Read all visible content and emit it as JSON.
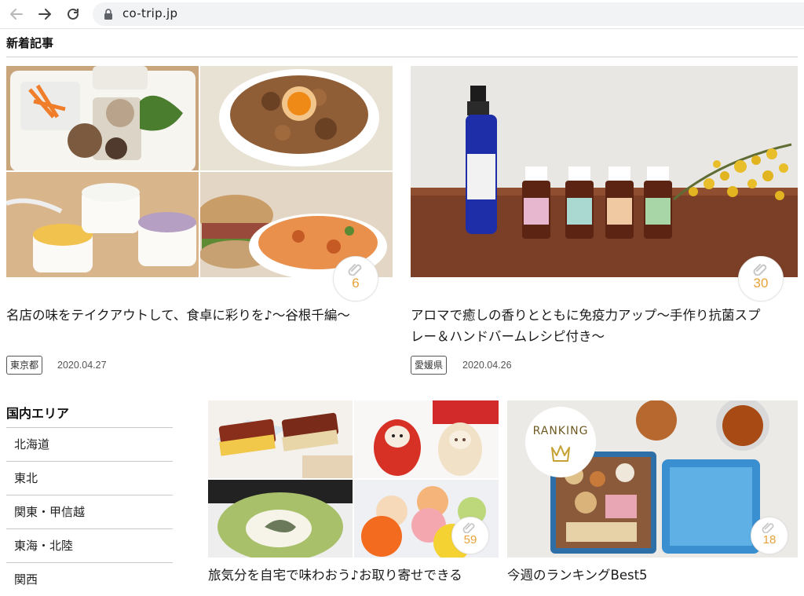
{
  "browser": {
    "url": "co-trip.jp",
    "icons": [
      "back-arrow-icon",
      "forward-arrow-icon",
      "reload-icon",
      "lock-icon"
    ]
  },
  "section": {
    "title": "新着記事"
  },
  "featured": [
    {
      "title": "名店の味をテイクアウトして、食卓に彩りを♪～谷根千編～",
      "clips": "6",
      "tag": "東京都",
      "date": "2020.04.27"
    },
    {
      "title_lines": [
        "アロマで癒しの香りとともに免疫力アップ～手作り抗菌スプ",
        "レー＆ハンドバームレシピ付き～"
      ],
      "clips": "30",
      "tag": "愛媛県",
      "date": "2020.04.26"
    }
  ],
  "sidebar": {
    "title": "国内エリア",
    "items": [
      "北海道",
      "東北",
      "関東・甲信越",
      "東海・北陸",
      "関西"
    ]
  },
  "cards": [
    {
      "title": "旅気分を自宅で味わおう♪お取り寄せできる",
      "clips": "59"
    },
    {
      "title": "今週のランキングBest5",
      "clips": "18",
      "badge": "RANKING"
    }
  ],
  "colors": {
    "accent": "#e9a23b",
    "url_bar": "#f1f3f4"
  }
}
